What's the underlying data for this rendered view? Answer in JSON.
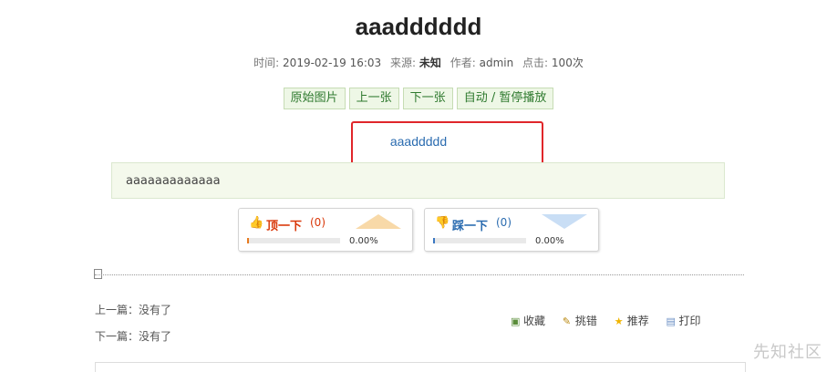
{
  "article": {
    "title": "aaadddddd",
    "meta": {
      "time_label": "时间:",
      "time_value": "2019-02-19 16:03",
      "source_label": "来源:",
      "source_value": "未知",
      "author_label": "作者:",
      "author_value": "admin",
      "clicks_label": "点击:",
      "clicks_value": "100次"
    },
    "image_link": "aaaddddd",
    "content": "aaaaaaaaaaaaa"
  },
  "gallery_controls": {
    "original": "原始图片",
    "prev": "上一张",
    "next": "下一张",
    "autoplay": "自动 / 暂停播放"
  },
  "vote": {
    "up": {
      "label": "顶一下",
      "count": "(0)",
      "percent": "0.00%",
      "ratio": 0
    },
    "down": {
      "label": "踩一下",
      "count": "(0)",
      "percent": "0.00%",
      "ratio": 0
    }
  },
  "nav": {
    "prev_label": "上一篇：",
    "prev_value": "没有了",
    "next_label": "下一篇：",
    "next_value": "没有了"
  },
  "actions": {
    "favorite": "收藏",
    "report": "挑错",
    "recommend": "推荐",
    "print": "打印"
  },
  "watermark": "先知社区",
  "colors": {
    "highlight_box": "#e0262a",
    "vote_up": "#d9380a",
    "vote_down": "#2b6cb0"
  }
}
